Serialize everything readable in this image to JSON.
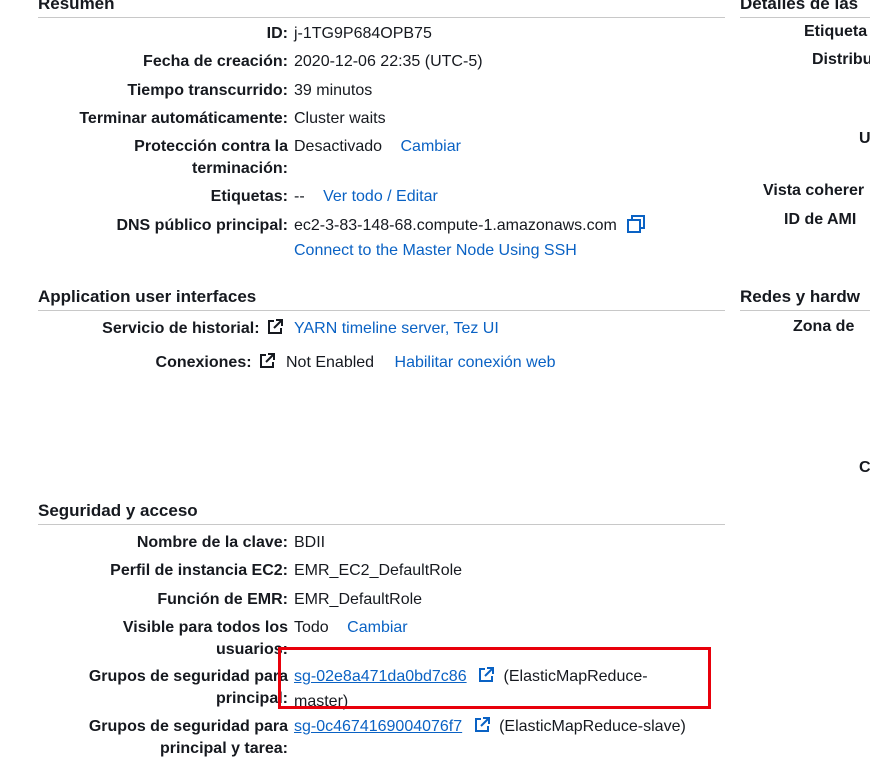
{
  "resumen": {
    "heading": "Resumen",
    "id_label": "ID:",
    "id_value": "j-1TG9P684OPB75",
    "created_label": "Fecha de creación:",
    "created_value": "2020-12-06 22:35 (UTC-5)",
    "elapsed_label": "Tiempo transcurrido:",
    "elapsed_value": "39 minutos",
    "autoterm_label": "Terminar automáticamente:",
    "autoterm_value": "Cluster waits",
    "protection_label_1": "Protección contra la",
    "protection_label_2": "terminación:",
    "protection_value": "Desactivado",
    "protection_change": "Cambiar",
    "tags_label": "Etiquetas:",
    "tags_value": "--",
    "tags_link": "Ver todo / Editar",
    "dns_label": "DNS público principal:",
    "dns_value": "ec2-3-83-148-68.compute-1.amazonaws.com",
    "ssh_link": "Connect to the Master Node Using SSH"
  },
  "app_ui": {
    "heading": "Application user interfaces",
    "history_label": "Servicio de historial:",
    "history_link": "YARN timeline server, Tez UI",
    "connections_label": "Conexiones:",
    "connections_value": "Not Enabled",
    "connections_link": "Habilitar conexión web"
  },
  "security": {
    "heading": "Seguridad y acceso",
    "key_label": "Nombre de la clave:",
    "key_value": "BDII",
    "profile_label": "Perfil de instancia EC2:",
    "profile_value": "EMR_EC2_DefaultRole",
    "role_label": "Función de EMR:",
    "role_value": "EMR_DefaultRole",
    "visible_label_1": "Visible para todos los",
    "visible_label_2": "usuarios:",
    "visible_value": "Todo",
    "visible_change": "Cambiar",
    "sg_master_label_1": "Grupos de seguridad para",
    "sg_master_label_2": "principal:",
    "sg_master_link": "sg-02e8a471da0bd7c86",
    "sg_master_desc_1": "(ElasticMapReduce-",
    "sg_master_desc_2": "master)",
    "sg_slave_label_1": "Grupos de seguridad para",
    "sg_slave_label_2": "principal y tarea:",
    "sg_slave_link": "sg-0c4674169004076f7",
    "sg_slave_desc": "(ElasticMapReduce-slave)"
  },
  "right": {
    "heading_1": "Detalles de las",
    "etiqueta": "Etiqueta",
    "distrib": "Distribu",
    "u": "U",
    "vista": "Vista coherer",
    "ami": "ID de AMI",
    "heading_2": "Redes y hardw",
    "zona": "Zona de",
    "c": "C"
  },
  "colors": {
    "link": "#0a62c4",
    "highlight": "#e8000b",
    "rule": "#c8c8c8"
  }
}
